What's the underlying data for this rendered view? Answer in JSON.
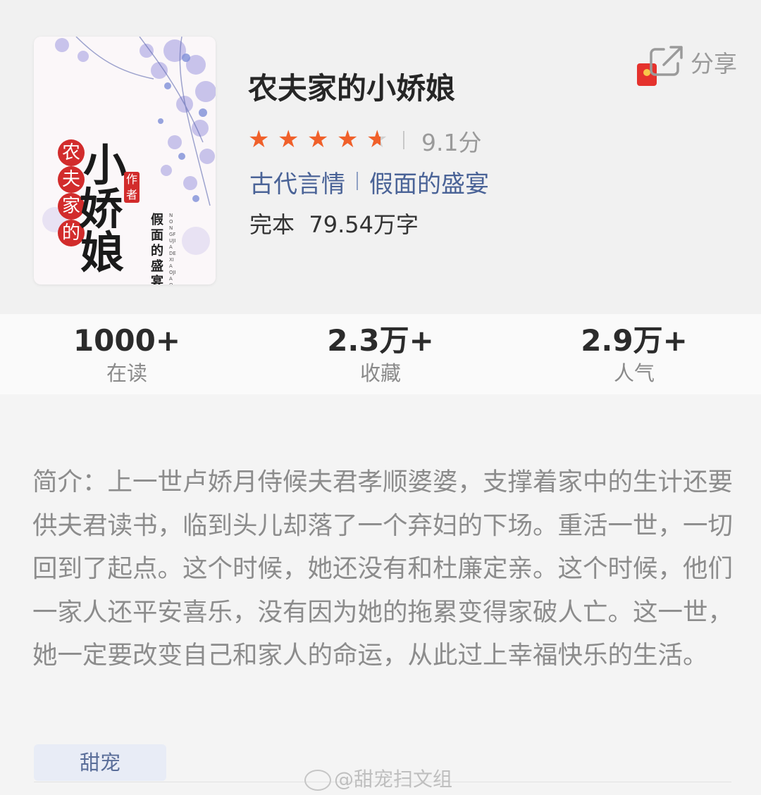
{
  "book": {
    "title": "农夫家的小娇娘",
    "rating": "9.1分",
    "rating_value": 4.5,
    "rating_max": 5,
    "genre": "古代言情",
    "author": "假面的盛宴",
    "status_words": "完本  79.54万字"
  },
  "cover": {
    "small_chars": [
      "农",
      "夫",
      "家",
      "的"
    ],
    "big_chars": [
      "小",
      "娇",
      "娘"
    ],
    "author_tag": "作者",
    "author_name": "假面的盛宴",
    "pinyin": "NONGFUJIADEXIAOJIAONIANG"
  },
  "share": {
    "label": "分享"
  },
  "stats": [
    {
      "value": "1000+",
      "label": "在读"
    },
    {
      "value": "2.3万+",
      "label": "收藏"
    },
    {
      "value": "2.9万+",
      "label": "人气"
    }
  ],
  "intro": "简介：上一世卢娇月侍候夫君孝顺婆婆，支撑着家中的生计还要供夫君读书，临到头儿却落了一个弃妇的下场。重活一世，一切回到了起点。这个时候，她还没有和杜廉定亲。这个时候，他们一家人还平安喜乐，没有因为她的拖累变得家破人亡。这一世，她一定要改变自己和家人的命运，从此过上幸福快乐的生活。",
  "tags": [
    "甜宠"
  ],
  "watermark": "@甜宠扫文组",
  "colors": {
    "star": "#f0602a",
    "link": "#4a6397",
    "seal": "#d22c2c"
  }
}
